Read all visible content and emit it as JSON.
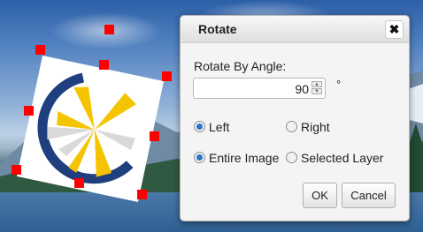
{
  "dialog": {
    "title": "Rotate",
    "close_glyph": "✖",
    "angle_label": "Rotate By Angle:",
    "angle_value": "90",
    "angle_unit": "°",
    "direction_options": [
      {
        "label": "Left",
        "checked": true
      },
      {
        "label": "Right",
        "checked": false
      }
    ],
    "scope_options": [
      {
        "label": "Entire Image",
        "checked": true
      },
      {
        "label": "Selected Layer",
        "checked": false
      }
    ],
    "ok_label": "OK",
    "cancel_label": "Cancel"
  },
  "icons": {
    "close": "close-icon",
    "spin_up": "caret-up-icon",
    "spin_down": "caret-down-icon"
  },
  "colors": {
    "selection_handle": "#ff0000",
    "radio_accent": "#2a73c5",
    "logo_navy": "#1f3f7f",
    "logo_yellow": "#f5c400"
  }
}
